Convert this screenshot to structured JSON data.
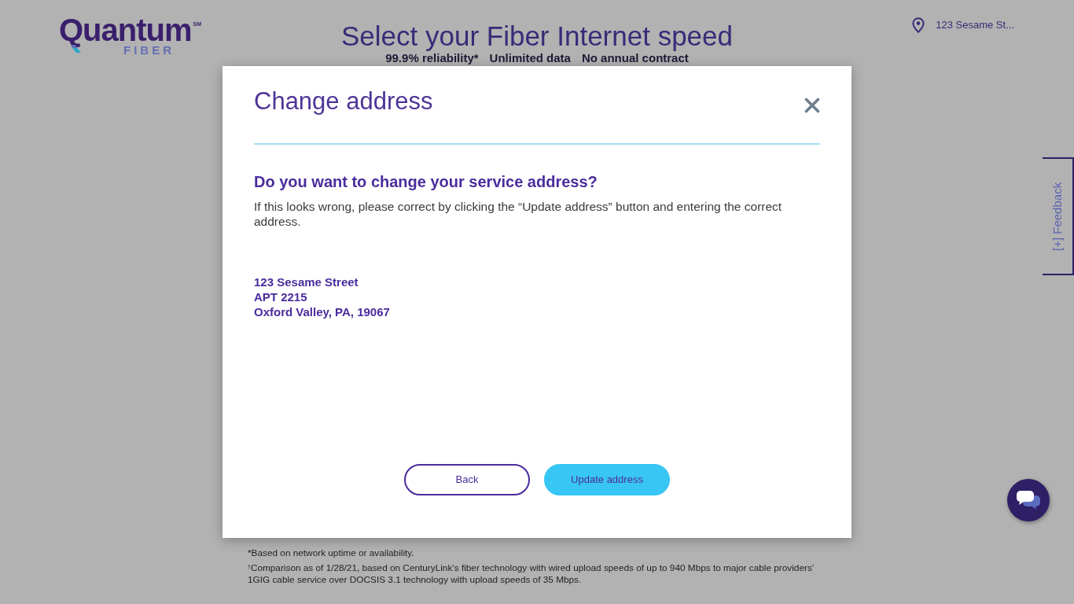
{
  "header": {
    "logo": {
      "wordmark": "Quantum",
      "mark": "SM",
      "subbrand": "FIBER"
    },
    "title": "Select your Fiber Internet speed",
    "highlights": [
      "99.9% reliability*",
      "Unlimited data",
      "No annual contract"
    ],
    "location": {
      "address": "123 Sesame St..."
    }
  },
  "dialog": {
    "title": "Change address",
    "question": "Do you want to change your service address?",
    "message": "If this looks wrong, please correct by clicking the “Update address” button and entering the correct address.",
    "address_lines": [
      "123 Sesame Street",
      "APT 2215",
      "Oxford Valley, PA, 19067"
    ],
    "buttons": [
      {
        "label": "Back",
        "kind": "secondary"
      },
      {
        "label": "Update address",
        "kind": "primary"
      }
    ]
  },
  "footnotes": [
    "*Based on network uptime or availability.",
    "$^{†}$Comparison as of 1/28/21, based on CenturyLink’s fiber technology with wired upload speeds of up to 940 Mbps to major cable providers’ 1GIG cable service over DOCSIS 3.1 technology with upload speeds of 35 Mbps."
  ],
  "feedback_tab": {
    "label": "[+] Feedback"
  }
}
